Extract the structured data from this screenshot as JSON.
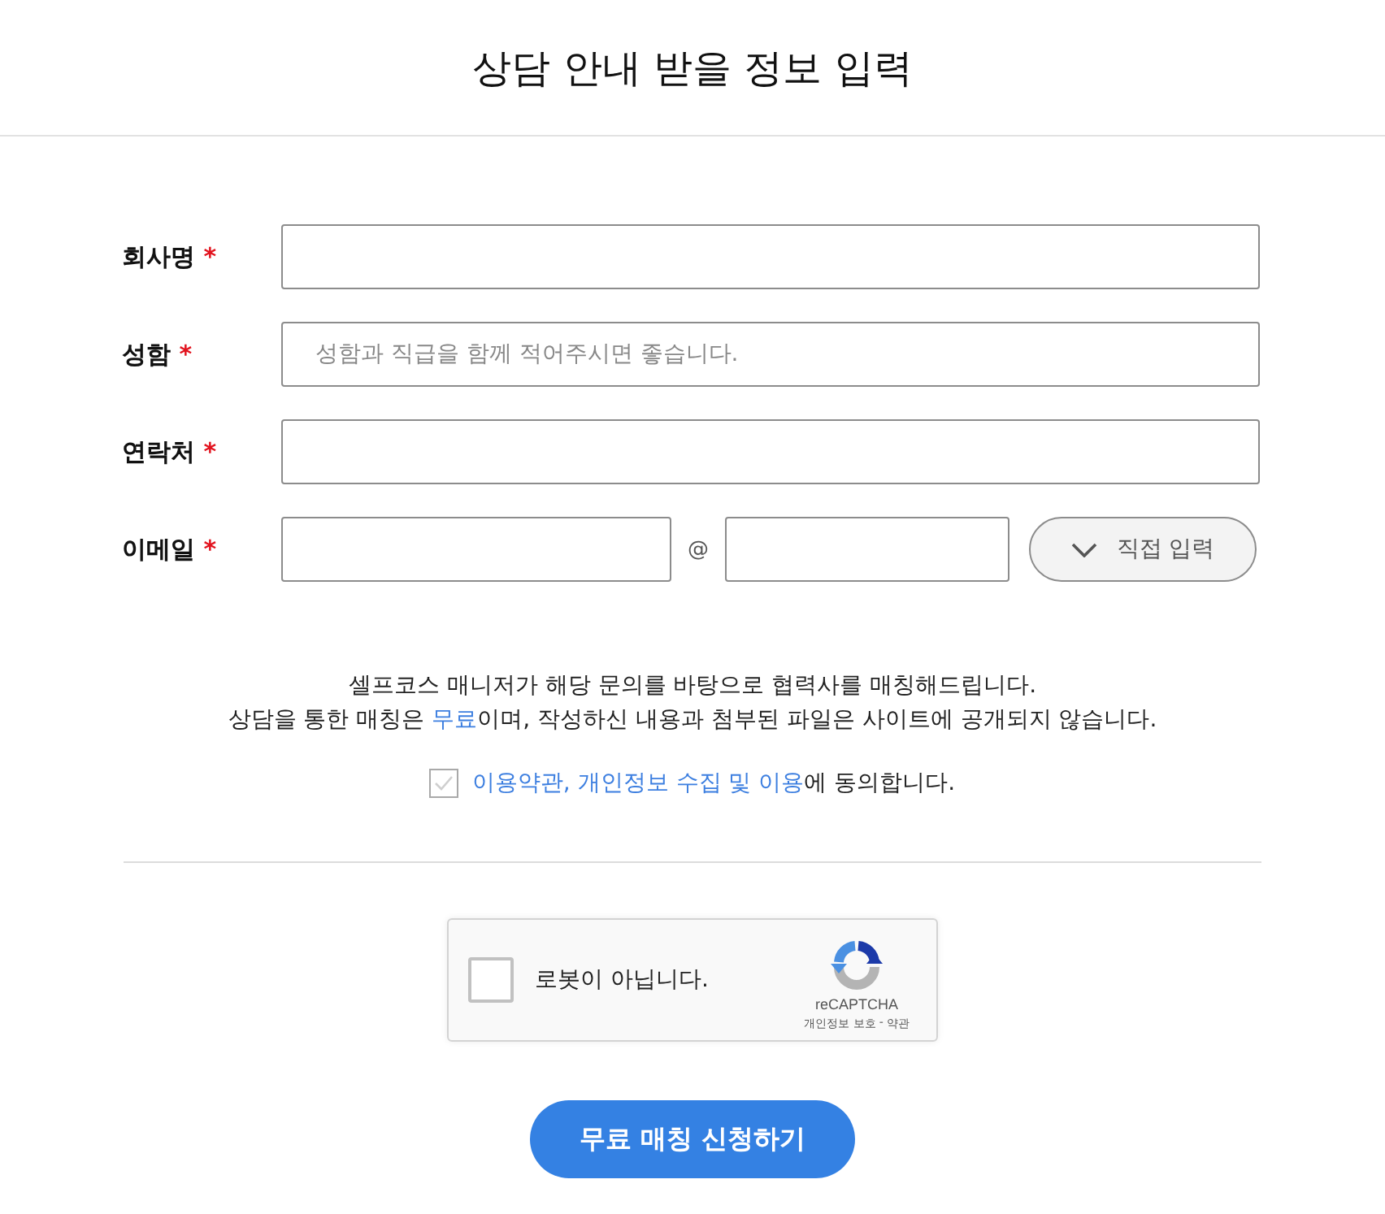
{
  "header": {
    "title": "상담 안내 받을 정보 입력"
  },
  "fields": [
    {
      "kind": "text",
      "label": "회사명",
      "marker": "*"
    },
    {
      "kind": "text",
      "label": "성함",
      "marker": "*",
      "placeholder": "성함과 직급을 함께 적어주시면 좋습니다."
    },
    {
      "kind": "text",
      "label": "연락처",
      "marker": "*"
    },
    {
      "kind": "email",
      "label": "이메일",
      "marker": "*",
      "separator": "@",
      "button": "직접 입력"
    }
  ],
  "notice": {
    "lines": [
      {
        "segments": [
          {
            "text": "셀프코스 매니저가 해당 문의를 바탕으로 협력사를 매칭해드립니다.",
            "highlight": false
          }
        ]
      },
      {
        "segments": [
          {
            "text": "상담을 통한 매칭은 ",
            "highlight": false
          },
          {
            "text": "무료",
            "highlight": true
          },
          {
            "text": "이며, 작성하신 내용과 첨부된 파일은 사이트에 공개되지 않습니다.",
            "highlight": false
          }
        ]
      }
    ]
  },
  "agreement": {
    "checked": false,
    "segments": [
      {
        "text": "이용약관, 개인정보 수집 및 이용",
        "link": true
      },
      {
        "text": "에 동의합니다.",
        "link": false
      }
    ]
  },
  "captcha": {
    "checked": false,
    "label": "로봇이 아닙니다.",
    "brand": "reCAPTCHA",
    "privacy_link": "개인정보 보호",
    "separator": "-",
    "terms_link": "약관"
  },
  "submit": {
    "label": "무료 매칭 신청하기"
  }
}
